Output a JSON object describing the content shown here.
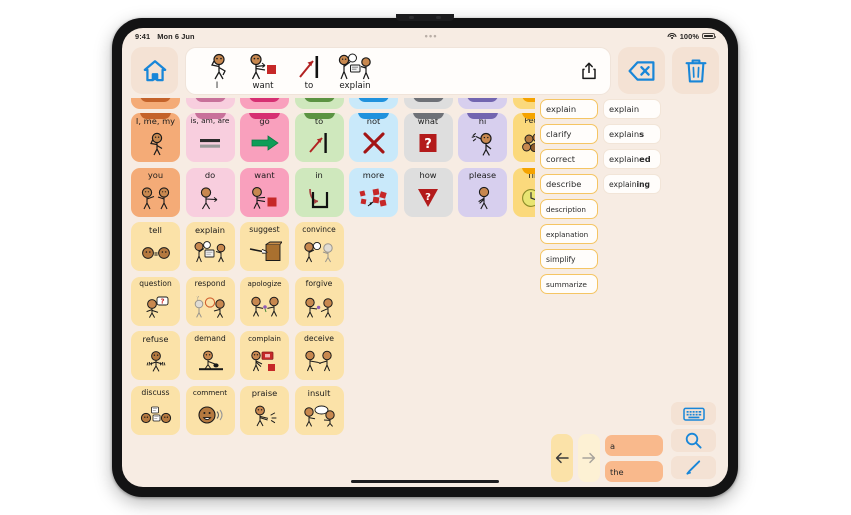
{
  "status_bar": {
    "time": "9:41",
    "date": "Mon 6 Jun",
    "handle": "•••",
    "battery_percent": "100%",
    "wifi_icon": "wifi-icon",
    "battery_icon": "battery-icon"
  },
  "toolbar": {
    "home_icon": "home-icon",
    "share_icon": "share-icon",
    "backspace_icon": "backspace-icon",
    "clear_icon": "trash-icon",
    "sentence": [
      {
        "label": "I",
        "art": "person-pointing-self"
      },
      {
        "label": "want",
        "art": "person-reaching-red-square"
      },
      {
        "label": "to",
        "art": "arrow-to-line"
      },
      {
        "label": "explain",
        "art": "person-explaining-board"
      }
    ]
  },
  "grid": {
    "partial_row": [
      {
        "tab": "#c4622a",
        "body": "#f4ab77"
      },
      {
        "tab": "#c8719a",
        "body": "#f8cede"
      },
      {
        "tab": "#d62f72",
        "body": "#f9a0bd"
      },
      {
        "tab": "#5b9342",
        "body": "#cfe8bd"
      },
      {
        "tab": "#2092dd",
        "body": "#c9e9fa"
      },
      {
        "tab": "#6e7177",
        "body": "#dedede"
      },
      {
        "tab": "#7265b0",
        "body": "#d7cfee"
      },
      {
        "tab": "#f5a300",
        "body": "#fbd97c"
      }
    ],
    "rows": [
      [
        {
          "label": "I, me, my",
          "bg": "#f4ab77",
          "tab": "#c4622a",
          "folder": true,
          "art": "person-pointing-self"
        },
        {
          "label": "is, am, are",
          "bg": "#f8cede",
          "tab": "#c8719a",
          "folder": true,
          "art": "equals-sign"
        },
        {
          "label": "go",
          "bg": "#f9a0bd",
          "tab": "#d62f72",
          "folder": true,
          "art": "green-arrow-right"
        },
        {
          "label": "to",
          "bg": "#cfe8bd",
          "tab": "#5b9342",
          "folder": true,
          "art": "arrow-to-line"
        },
        {
          "label": "not",
          "bg": "#c9e9fa",
          "tab": "#2092dd",
          "folder": true,
          "art": "red-x"
        },
        {
          "label": "what",
          "bg": "#dedede",
          "tab": "#6e7177",
          "folder": true,
          "art": "red-question-box"
        },
        {
          "label": "hi",
          "bg": "#d7cfee",
          "tab": "#7265b0",
          "folder": true,
          "art": "person-waving"
        },
        {
          "label": "People",
          "bg": "#fbd97c",
          "tab": "#f5a300",
          "folder": true,
          "art": "group-of-faces"
        }
      ],
      [
        {
          "label": "you",
          "bg": "#f4ab77",
          "folder": false,
          "art": "two-people-pointing"
        },
        {
          "label": "do",
          "bg": "#f8cede",
          "folder": false,
          "art": "person-doing"
        },
        {
          "label": "want",
          "bg": "#f9a0bd",
          "folder": false,
          "art": "person-reaching-red-square"
        },
        {
          "label": "in",
          "bg": "#cfe8bd",
          "folder": false,
          "art": "arrow-into-box"
        },
        {
          "label": "more",
          "bg": "#c9e9fa",
          "folder": false,
          "art": "red-cubes-cluster"
        },
        {
          "label": "how",
          "bg": "#dedede",
          "folder": false,
          "art": "red-question-triangle"
        },
        {
          "label": "please",
          "bg": "#d7cfee",
          "folder": false,
          "art": "person-please"
        },
        {
          "label": "Time",
          "bg": "#fbd97c",
          "tab": "#f5a300",
          "folder": true,
          "art": "clock-calendar"
        }
      ],
      [
        {
          "label": "tell",
          "bg": "#fbe2a8",
          "folder": false,
          "art": "two-heads-talking"
        },
        {
          "label": "explain",
          "bg": "#fbe2a8",
          "folder": false,
          "art": "person-explaining-board"
        },
        {
          "label": "suggest",
          "bg": "#fbe2a8",
          "folder": false,
          "art": "hand-pointing-box"
        },
        {
          "label": "convince",
          "bg": "#fbe2a8",
          "folder": false,
          "art": "person-convincing"
        }
      ],
      [
        {
          "label": "question",
          "bg": "#fbe2a8",
          "folder": false,
          "art": "person-question-bubble"
        },
        {
          "label": "respond",
          "bg": "#fbe2a8",
          "folder": false,
          "art": "two-people-responding"
        },
        {
          "label": "apologize",
          "bg": "#fbe2a8",
          "folder": false,
          "art": "person-giving-flower"
        },
        {
          "label": "forgive",
          "bg": "#fbe2a8",
          "folder": false,
          "art": "person-forgiving"
        }
      ],
      [
        {
          "label": "refuse",
          "bg": "#fbe2a8",
          "folder": false,
          "art": "person-hands-up-refusing"
        },
        {
          "label": "demand",
          "bg": "#fbe2a8",
          "folder": false,
          "art": "person-fist-on-table"
        },
        {
          "label": "complain",
          "bg": "#fbe2a8",
          "folder": false,
          "art": "person-complaining-red-bubble"
        },
        {
          "label": "deceive",
          "bg": "#fbe2a8",
          "folder": false,
          "art": "person-deceiving"
        }
      ],
      [
        {
          "label": "discuss",
          "bg": "#fbe2a8",
          "folder": false,
          "art": "two-heads-speech-bubbles"
        },
        {
          "label": "comment",
          "bg": "#fbe2a8",
          "folder": false,
          "art": "head-talking-waves"
        },
        {
          "label": "praise",
          "bg": "#fbe2a8",
          "folder": false,
          "art": "person-clapping"
        },
        {
          "label": "insult",
          "bg": "#fbe2a8",
          "folder": false,
          "art": "person-insulting-bubble"
        }
      ]
    ]
  },
  "predictions": {
    "core_words": [
      "explain",
      "clarify",
      "correct",
      "describe",
      "description",
      "explanation",
      "simplify",
      "summarize"
    ],
    "inflections": [
      {
        "stem": "explain",
        "suffix": ""
      },
      {
        "stem": "explain",
        "suffix": "s"
      },
      {
        "stem": "explain",
        "suffix": "ed"
      },
      {
        "stem": "explain",
        "suffix": "ing"
      }
    ]
  },
  "bottom": {
    "back_icon": "arrow-left-icon",
    "forward_icon": "arrow-right-icon",
    "articles": [
      "a",
      "the"
    ],
    "keyboard_icon": "keyboard-icon",
    "search_icon": "search-icon",
    "edit_icon": "pencil-icon"
  }
}
